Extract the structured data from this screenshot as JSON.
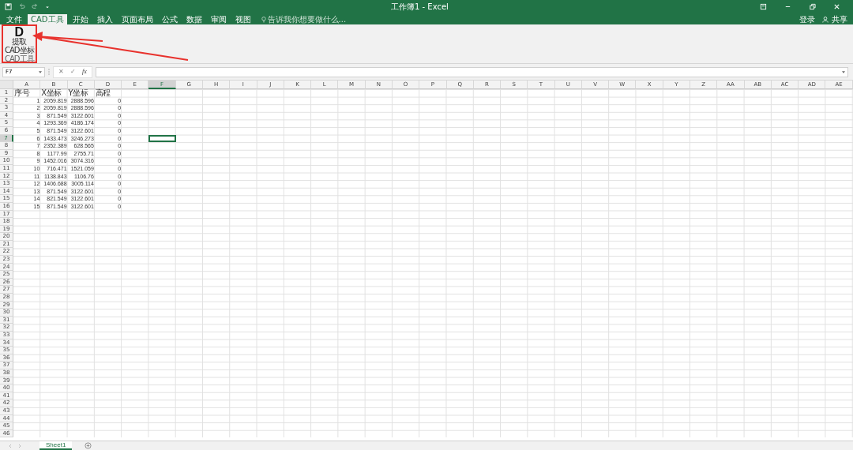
{
  "window": {
    "title": "工作簿1 - Excel",
    "sign_in": "登录",
    "share": "共享"
  },
  "ribbon_tabs": [
    {
      "label": "文件",
      "selected": false
    },
    {
      "label": "CAD工具",
      "selected": true
    },
    {
      "label": "开始",
      "selected": false
    },
    {
      "label": "插入",
      "selected": false
    },
    {
      "label": "页面布局",
      "selected": false
    },
    {
      "label": "公式",
      "selected": false
    },
    {
      "label": "数据",
      "selected": false
    },
    {
      "label": "审阅",
      "selected": false
    },
    {
      "label": "视图",
      "selected": false
    }
  ],
  "tell_me": {
    "placeholder": "告诉我你想要做什么..."
  },
  "ribbon": {
    "button_glyph": "D",
    "button_label": "提取\nCAD坐标",
    "group_label": "CAD工具"
  },
  "formula_bar": {
    "name_box": "F7",
    "cancel_glyph": "✕",
    "enter_glyph": "✓",
    "function_glyph": "fx"
  },
  "columns": [
    {
      "label": "A",
      "selected": false
    },
    {
      "label": "B",
      "selected": false
    },
    {
      "label": "C",
      "selected": false
    },
    {
      "label": "D",
      "selected": false
    },
    {
      "label": "E",
      "selected": false
    },
    {
      "label": "F",
      "selected": true
    },
    {
      "label": "G",
      "selected": false
    },
    {
      "label": "H",
      "selected": false
    },
    {
      "label": "I",
      "selected": false
    },
    {
      "label": "J",
      "selected": false
    },
    {
      "label": "K",
      "selected": false
    },
    {
      "label": "L",
      "selected": false
    },
    {
      "label": "M",
      "selected": false
    },
    {
      "label": "N",
      "selected": false
    },
    {
      "label": "O",
      "selected": false
    },
    {
      "label": "P",
      "selected": false
    },
    {
      "label": "Q",
      "selected": false
    },
    {
      "label": "R",
      "selected": false
    },
    {
      "label": "S",
      "selected": false
    },
    {
      "label": "T",
      "selected": false
    },
    {
      "label": "U",
      "selected": false
    },
    {
      "label": "V",
      "selected": false
    },
    {
      "label": "W",
      "selected": false
    },
    {
      "label": "X",
      "selected": false
    },
    {
      "label": "Y",
      "selected": false
    },
    {
      "label": "Z",
      "selected": false
    },
    {
      "label": "AA",
      "selected": false
    },
    {
      "label": "AB",
      "selected": false
    },
    {
      "label": "AC",
      "selected": false
    },
    {
      "label": "AD",
      "selected": false
    },
    {
      "label": "AE",
      "selected": false
    }
  ],
  "rows": [
    {
      "label": "1",
      "selected": false,
      "cells": [
        {
          "text": "序号",
          "kind": "text"
        },
        {
          "text": "X坐标",
          "kind": "text"
        },
        {
          "text": "Y坐标",
          "kind": "text"
        },
        {
          "text": "高程",
          "kind": "text"
        }
      ]
    },
    {
      "label": "2",
      "selected": false,
      "cells": [
        {
          "text": "1",
          "kind": "number"
        },
        {
          "text": "2059.819",
          "kind": "number"
        },
        {
          "text": "2888.596",
          "kind": "number"
        },
        {
          "text": "0",
          "kind": "number"
        }
      ]
    },
    {
      "label": "3",
      "selected": false,
      "cells": [
        {
          "text": "2",
          "kind": "number"
        },
        {
          "text": "2059.819",
          "kind": "number"
        },
        {
          "text": "2888.596",
          "kind": "number"
        },
        {
          "text": "0",
          "kind": "number"
        }
      ]
    },
    {
      "label": "4",
      "selected": false,
      "cells": [
        {
          "text": "3",
          "kind": "number"
        },
        {
          "text": "871.549",
          "kind": "number"
        },
        {
          "text": "3122.601",
          "kind": "number"
        },
        {
          "text": "0",
          "kind": "number"
        }
      ]
    },
    {
      "label": "5",
      "selected": false,
      "cells": [
        {
          "text": "4",
          "kind": "number"
        },
        {
          "text": "1293.369",
          "kind": "number"
        },
        {
          "text": "4186.174",
          "kind": "number"
        },
        {
          "text": "0",
          "kind": "number"
        }
      ]
    },
    {
      "label": "6",
      "selected": false,
      "cells": [
        {
          "text": "5",
          "kind": "number"
        },
        {
          "text": "871.549",
          "kind": "number"
        },
        {
          "text": "3122.601",
          "kind": "number"
        },
        {
          "text": "0",
          "kind": "number"
        }
      ]
    },
    {
      "label": "7",
      "selected": true,
      "cells": [
        {
          "text": "6",
          "kind": "number"
        },
        {
          "text": "1433.473",
          "kind": "number"
        },
        {
          "text": "3246.273",
          "kind": "number"
        },
        {
          "text": "0",
          "kind": "number"
        }
      ]
    },
    {
      "label": "8",
      "selected": false,
      "cells": [
        {
          "text": "7",
          "kind": "number"
        },
        {
          "text": "2352.389",
          "kind": "number"
        },
        {
          "text": "628.565",
          "kind": "number"
        },
        {
          "text": "0",
          "kind": "number"
        }
      ]
    },
    {
      "label": "9",
      "selected": false,
      "cells": [
        {
          "text": "8",
          "kind": "number"
        },
        {
          "text": "1177.99",
          "kind": "number"
        },
        {
          "text": "2755.71",
          "kind": "number"
        },
        {
          "text": "0",
          "kind": "number"
        }
      ]
    },
    {
      "label": "10",
      "selected": false,
      "cells": [
        {
          "text": "9",
          "kind": "number"
        },
        {
          "text": "1452.016",
          "kind": "number"
        },
        {
          "text": "3074.316",
          "kind": "number"
        },
        {
          "text": "0",
          "kind": "number"
        }
      ]
    },
    {
      "label": "11",
      "selected": false,
      "cells": [
        {
          "text": "10",
          "kind": "number"
        },
        {
          "text": "716.471",
          "kind": "number"
        },
        {
          "text": "1521.059",
          "kind": "number"
        },
        {
          "text": "0",
          "kind": "number"
        }
      ]
    },
    {
      "label": "12",
      "selected": false,
      "cells": [
        {
          "text": "11",
          "kind": "number"
        },
        {
          "text": "1138.843",
          "kind": "number"
        },
        {
          "text": "1106.76",
          "kind": "number"
        },
        {
          "text": "0",
          "kind": "number"
        }
      ]
    },
    {
      "label": "13",
      "selected": false,
      "cells": [
        {
          "text": "12",
          "kind": "number"
        },
        {
          "text": "1406.688",
          "kind": "number"
        },
        {
          "text": "3005.114",
          "kind": "number"
        },
        {
          "text": "0",
          "kind": "number"
        }
      ]
    },
    {
      "label": "14",
      "selected": false,
      "cells": [
        {
          "text": "13",
          "kind": "number"
        },
        {
          "text": "871.549",
          "kind": "number"
        },
        {
          "text": "3122.601",
          "kind": "number"
        },
        {
          "text": "0",
          "kind": "number"
        }
      ]
    },
    {
      "label": "15",
      "selected": false,
      "cells": [
        {
          "text": "14",
          "kind": "number"
        },
        {
          "text": "821.549",
          "kind": "number"
        },
        {
          "text": "3122.601",
          "kind": "number"
        },
        {
          "text": "0",
          "kind": "number"
        }
      ]
    },
    {
      "label": "16",
      "selected": false,
      "cells": [
        {
          "text": "15",
          "kind": "number"
        },
        {
          "text": "871.549",
          "kind": "number"
        },
        {
          "text": "3122.601",
          "kind": "number"
        },
        {
          "text": "0",
          "kind": "number"
        }
      ]
    },
    {
      "label": "17",
      "selected": false
    },
    {
      "label": "18",
      "selected": false
    },
    {
      "label": "19",
      "selected": false
    },
    {
      "label": "20",
      "selected": false
    },
    {
      "label": "21",
      "selected": false
    },
    {
      "label": "22",
      "selected": false
    },
    {
      "label": "23",
      "selected": false
    },
    {
      "label": "24",
      "selected": false
    },
    {
      "label": "25",
      "selected": false
    },
    {
      "label": "26",
      "selected": false
    },
    {
      "label": "27",
      "selected": false
    },
    {
      "label": "28",
      "selected": false
    },
    {
      "label": "29",
      "selected": false
    },
    {
      "label": "30",
      "selected": false
    },
    {
      "label": "31",
      "selected": false
    },
    {
      "label": "32",
      "selected": false
    },
    {
      "label": "33",
      "selected": false
    },
    {
      "label": "34",
      "selected": false
    },
    {
      "label": "35",
      "selected": false
    },
    {
      "label": "36",
      "selected": false
    },
    {
      "label": "37",
      "selected": false
    },
    {
      "label": "38",
      "selected": false
    },
    {
      "label": "39",
      "selected": false
    },
    {
      "label": "40",
      "selected": false
    },
    {
      "label": "41",
      "selected": false
    },
    {
      "label": "42",
      "selected": false
    },
    {
      "label": "43",
      "selected": false
    },
    {
      "label": "44",
      "selected": false
    },
    {
      "label": "45",
      "selected": false
    },
    {
      "label": "46",
      "selected": false
    }
  ],
  "sheet_tabs": [
    {
      "label": "Sheet1",
      "selected": true
    }
  ]
}
